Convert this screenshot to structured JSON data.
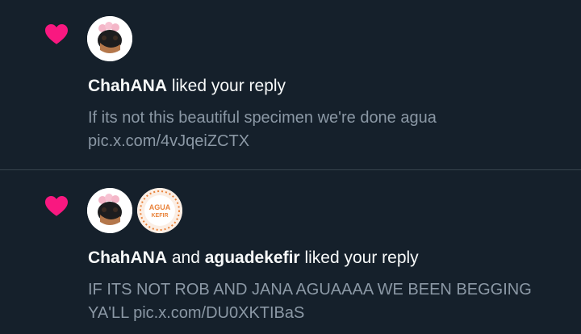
{
  "theme": {
    "background": "#15202b",
    "divider": "#38444d",
    "like_color": "#f91880",
    "primary_text": "#f7f9f9",
    "secondary_text": "#8b98a5"
  },
  "notifications": [
    {
      "icon": "heart-icon",
      "users": [
        "ChahANA"
      ],
      "joiner": "",
      "action": " liked your reply",
      "text": "If its not this beautiful specimen we're done agua ",
      "link": "pic.x.com/4vJqeiZCTX"
    },
    {
      "icon": "heart-icon",
      "users": [
        "ChahANA",
        "aguadekefir"
      ],
      "joiner": " and ",
      "action": " liked your reply",
      "text": "IF ITS NOT ROB AND JANA AGUAAAA WE BEEN BEGGING YA'LL ",
      "link": "pic.x.com/DU0XKTIBaS",
      "avatar_logo_lines": [
        "AGUA",
        "KEFIR"
      ]
    }
  ]
}
